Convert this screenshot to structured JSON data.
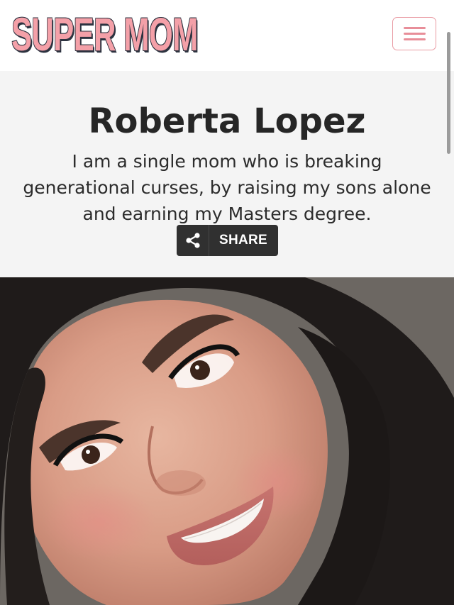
{
  "header": {
    "logo_text": "SUPER MOM",
    "menu_icon": "hamburger-menu-icon"
  },
  "profile": {
    "name": "Roberta Lopez",
    "bio": "I am a single mom who is breaking generational curses, by raising my sons alone and earning my Masters degree."
  },
  "share": {
    "label": "SHARE",
    "icon": "share-icon"
  },
  "colors": {
    "logo_fill": "#f4a0a8",
    "logo_outline": "#2d3340",
    "menu_accent": "#e88e99",
    "hero_background": "#f4f4f4",
    "share_button": "#303030"
  }
}
